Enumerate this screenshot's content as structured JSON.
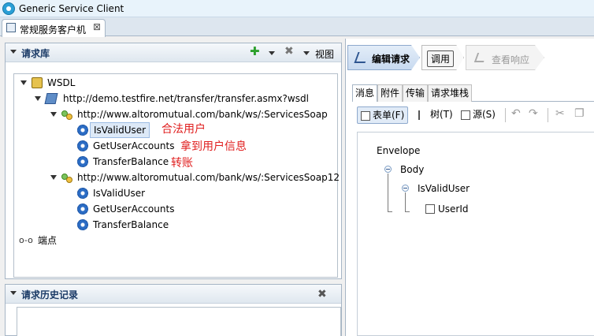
{
  "window": {
    "title": "Generic Service Client"
  },
  "doc_tab": {
    "label": "常规服务客户机",
    "close": "⊠"
  },
  "request_library": {
    "title": "请求库",
    "add_icon": "plus-icon",
    "delete_icon": "x-icon",
    "view_label": "视图"
  },
  "tree": {
    "root": "WSDL",
    "wsdl_url": "http://demo.testfire.net/transfer/transfer.asmx?wsdl",
    "binding1": "http://www.altoromutual.com/bank/ws/:ServicesSoap",
    "binding1_ops": [
      "IsValidUser",
      "GetUserAccounts",
      "TransferBalance"
    ],
    "binding2": "http://www.altoromutual.com/bank/ws/:ServicesSoap12",
    "binding2_ops": [
      "IsValidUser",
      "GetUserAccounts",
      "TransferBalance"
    ],
    "endpoint": "端点"
  },
  "annotations": [
    "合法用户",
    "拿到用户信息",
    "转账"
  ],
  "history": {
    "title": "请求历史记录"
  },
  "flow": {
    "edit": "编辑请求",
    "call": "调用",
    "response": "查看响应"
  },
  "subtabs": [
    "消息",
    "附件",
    "传输",
    "请求堆栈"
  ],
  "toolbar": {
    "form": "表单(F)",
    "tree": "树(T)",
    "source": "源(S)"
  },
  "envelope": {
    "envelope": "Envelope",
    "body": "Body",
    "op": "IsValidUser",
    "field": "UserId"
  }
}
